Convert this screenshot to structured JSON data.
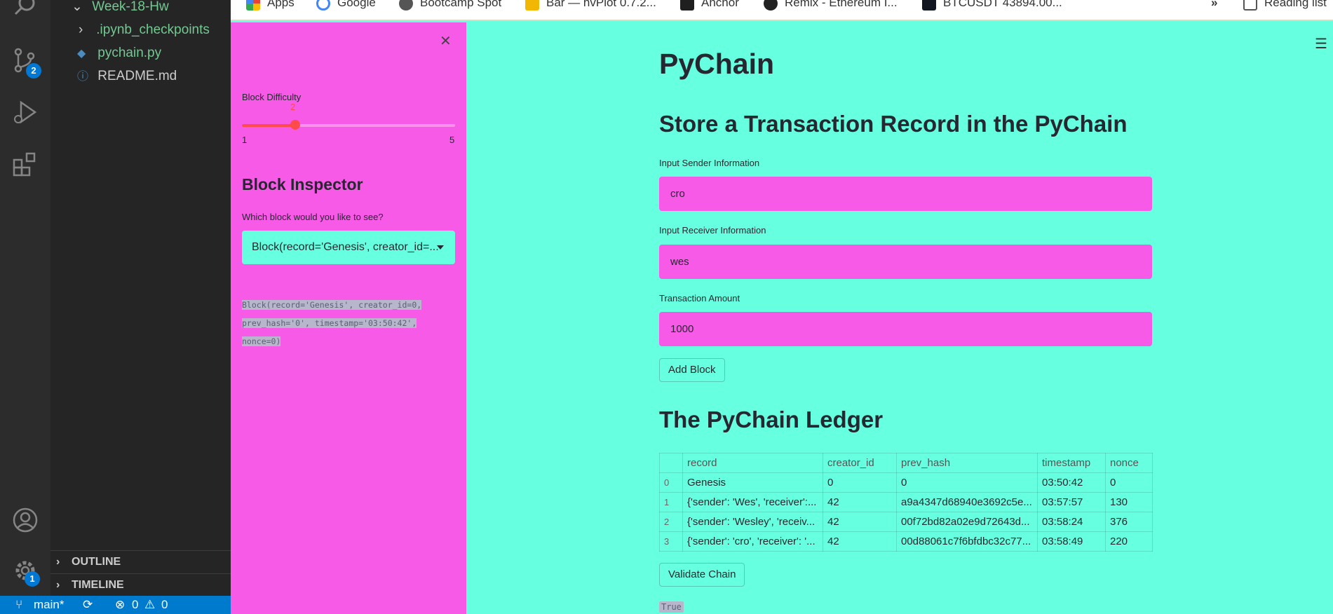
{
  "vscode": {
    "explorer": {
      "folder": "Week-18-Hw",
      "items": [
        ".ipynb_checkpoints",
        "pychain.py",
        "README.md"
      ],
      "outline": "OUTLINE",
      "timeline": "TIMELINE"
    },
    "badges": {
      "source_control": "2",
      "settings": "1"
    },
    "statusbar": {
      "branch": "main*",
      "errors": "0",
      "warnings": "0"
    }
  },
  "browser": {
    "bookmarks": [
      "Apps",
      "Google",
      "Bootcamp Spot",
      "Bar — hvPlot 0.7.2...",
      "Anchor",
      "Remix - Ethereum I...",
      "BTCUSDT 43894.00...",
      "»",
      "Reading list"
    ]
  },
  "sidebar": {
    "difficulty_label": "Block Difficulty",
    "difficulty_value": "2",
    "difficulty_level": 2,
    "difficulty_min": "1",
    "difficulty_max": "5",
    "inspector_title": "Block Inspector",
    "inspector_prompt": "Which block would you like to see?",
    "selected_block": "Block(record='Genesis', creator_id=...",
    "block_output": {
      "line1": "Block(record='Genesis', creator_id=0,",
      "line2": "prev_hash='0', timestamp='03:50:42',",
      "line3": "nonce=0)"
    }
  },
  "main": {
    "title": "PyChain",
    "form_title": "Store a Transaction Record in the PyChain",
    "sender_label": "Input Sender Information",
    "sender_value": "cro",
    "receiver_label": "Input Receiver Information",
    "receiver_value": "wes",
    "amount_label": "Transaction Amount",
    "amount_value": "1000",
    "add_button": "Add Block",
    "ledger_title": "The PyChain Ledger",
    "ledger": {
      "columns": [
        "record",
        "creator_id",
        "prev_hash",
        "timestamp",
        "nonce"
      ],
      "rows": [
        {
          "idx": "0",
          "record": "Genesis",
          "creator_id": "0",
          "prev_hash": "0",
          "timestamp": "03:50:42",
          "nonce": "0"
        },
        {
          "idx": "1",
          "record": "{'sender': 'Wes', 'receiver':...",
          "creator_id": "42",
          "prev_hash": "a9a4347d68940e3692c5e...",
          "timestamp": "03:57:57",
          "nonce": "130"
        },
        {
          "idx": "2",
          "record": "{'sender': 'Wesley', 'receiv...",
          "creator_id": "42",
          "prev_hash": "00f72bd82a02e9d72643d...",
          "timestamp": "03:58:24",
          "nonce": "376"
        },
        {
          "idx": "3",
          "record": "{'sender': 'cro', 'receiver': '...",
          "creator_id": "42",
          "prev_hash": "00d88061c7f6bfdbc32c77...",
          "timestamp": "03:58:49",
          "nonce": "220"
        }
      ]
    },
    "validate_button": "Validate Chain",
    "validate_result": "True"
  }
}
